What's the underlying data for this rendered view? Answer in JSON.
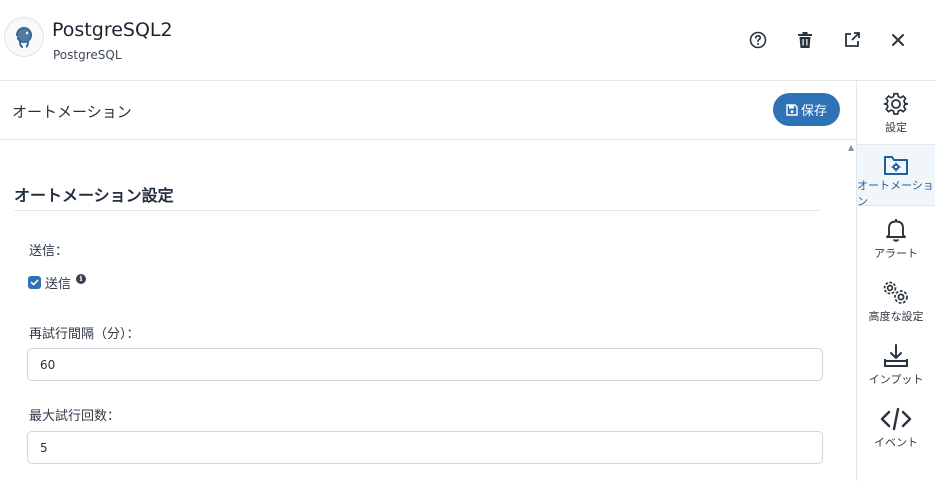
{
  "header": {
    "title": "PostgreSQL2",
    "subtitle": "PostgreSQL",
    "logo_icon": "postgresql-elephant-icon",
    "actions": [
      {
        "name": "help",
        "icon": "question-circle-icon"
      },
      {
        "name": "delete",
        "icon": "trash-icon"
      },
      {
        "name": "open-external",
        "icon": "external-link-icon"
      },
      {
        "name": "close",
        "icon": "close-icon"
      }
    ]
  },
  "section": {
    "title": "オートメーション",
    "save_label": "保存",
    "save_icon": "floppy-disk-icon"
  },
  "form": {
    "heading": "オートメーション設定",
    "send_label": "送信：",
    "send_checkbox_label": "送信",
    "send_checked": true,
    "retry_interval_label": "再試行間隔（分）：",
    "retry_interval_value": "60",
    "max_retries_label": "最大試行回数：",
    "max_retries_value": "5"
  },
  "rail": {
    "items": [
      {
        "label": "設定",
        "icon": "gear-icon",
        "active": false
      },
      {
        "label": "オートメーション",
        "icon": "folder-gear-icon",
        "active": true
      },
      {
        "label": "アラート",
        "icon": "bell-icon",
        "active": false
      },
      {
        "label": "高度な設定",
        "icon": "gears-icon",
        "active": false
      },
      {
        "label": "インプット",
        "icon": "download-tray-icon",
        "active": false
      },
      {
        "label": "イベント",
        "icon": "code-icon",
        "active": false
      }
    ]
  },
  "colors": {
    "accent": "#2d73b5",
    "border": "#e3e6ea",
    "text": "#1f2a37"
  }
}
